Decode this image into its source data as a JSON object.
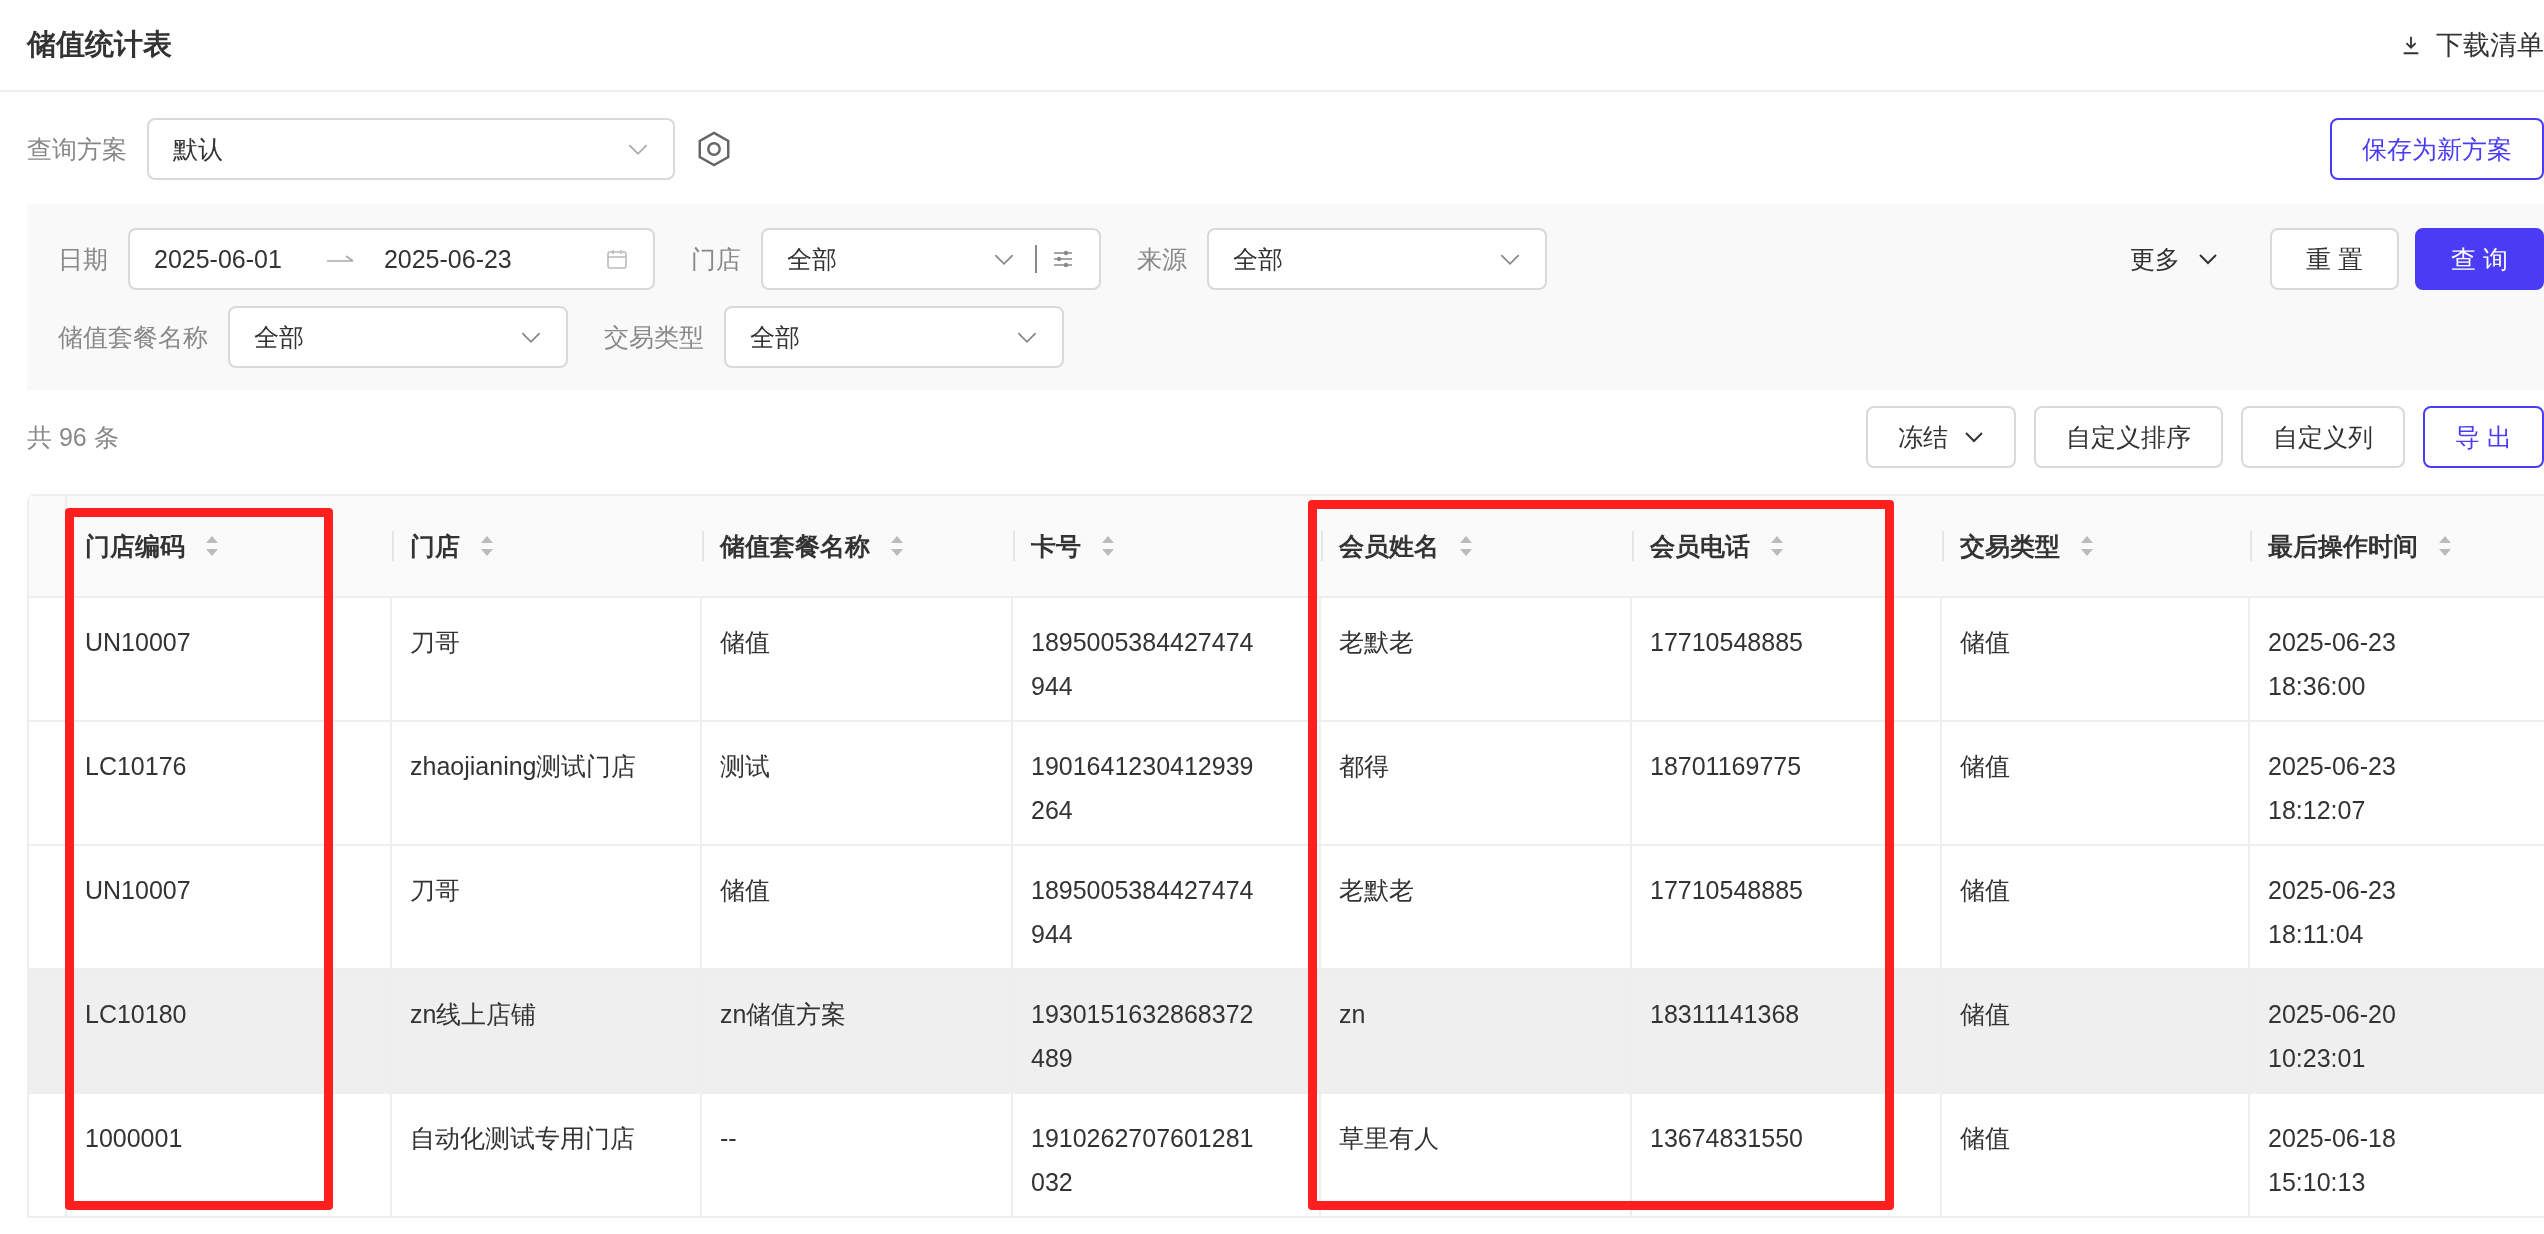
{
  "page_title": "储值统计表",
  "download_link": {
    "label": "下载清单"
  },
  "scheme": {
    "label": "查询方案",
    "value": "默认"
  },
  "save_button": "保存为新方案",
  "filter_rows": [
    [
      {
        "label": "日期",
        "kind": "daterange",
        "start": "2025-06-01",
        "end": "2025-06-23"
      },
      {
        "label": "门店",
        "kind": "select-options",
        "value": "全部"
      },
      {
        "label": "来源",
        "kind": "select",
        "value": "全部"
      }
    ],
    [
      {
        "label": "储值套餐名称",
        "kind": "select",
        "value": "全部"
      },
      {
        "label": "交易类型",
        "kind": "select",
        "value": "全部"
      }
    ]
  ],
  "more": "更多",
  "reset_button": "重 置",
  "query_button": "查 询",
  "total": "共 96 条",
  "toolbar": [
    {
      "label": "冻结",
      "kind": "dropdown"
    },
    {
      "label": "自定义排序",
      "kind": "plain"
    },
    {
      "label": "自定义列",
      "kind": "plain"
    },
    {
      "label": "导 出",
      "kind": "primary"
    }
  ],
  "table": {
    "columns": [
      "门店编码",
      "门店",
      "储值套餐名称",
      "卡号",
      "会员姓名",
      "会员电话",
      "交易类型",
      "最后操作时间"
    ],
    "rows": [
      {
        "highlighted": false,
        "cells": [
          "UN10007",
          "刀哥",
          "储值",
          "1895005384427474944",
          "老默老",
          "17710548885",
          "储值",
          "2025-06-23 18:36:00"
        ]
      },
      {
        "highlighted": false,
        "cells": [
          "LC10176",
          "zhaojianing测试门店",
          "测试",
          "1901641230412939264",
          "都得",
          "18701169775",
          "储值",
          "2025-06-23 18:12:07"
        ]
      },
      {
        "highlighted": false,
        "cells": [
          "UN10007",
          "刀哥",
          "储值",
          "1895005384427474944",
          "老默老",
          "17710548885",
          "储值",
          "2025-06-23 18:11:04"
        ]
      },
      {
        "highlighted": true,
        "cells": [
          "LC10180",
          "zn线上店铺",
          "zn储值方案",
          "1930151632868372489",
          "zn",
          "18311141368",
          "储值",
          "2025-06-20 10:23:01"
        ]
      },
      {
        "highlighted": false,
        "cells": [
          "1000001",
          "自动化测试专用门店",
          "--",
          "1910262707601281032",
          "草里有人",
          "13674831550",
          "储值",
          "2025-06-18 15:10:13"
        ]
      }
    ]
  }
}
